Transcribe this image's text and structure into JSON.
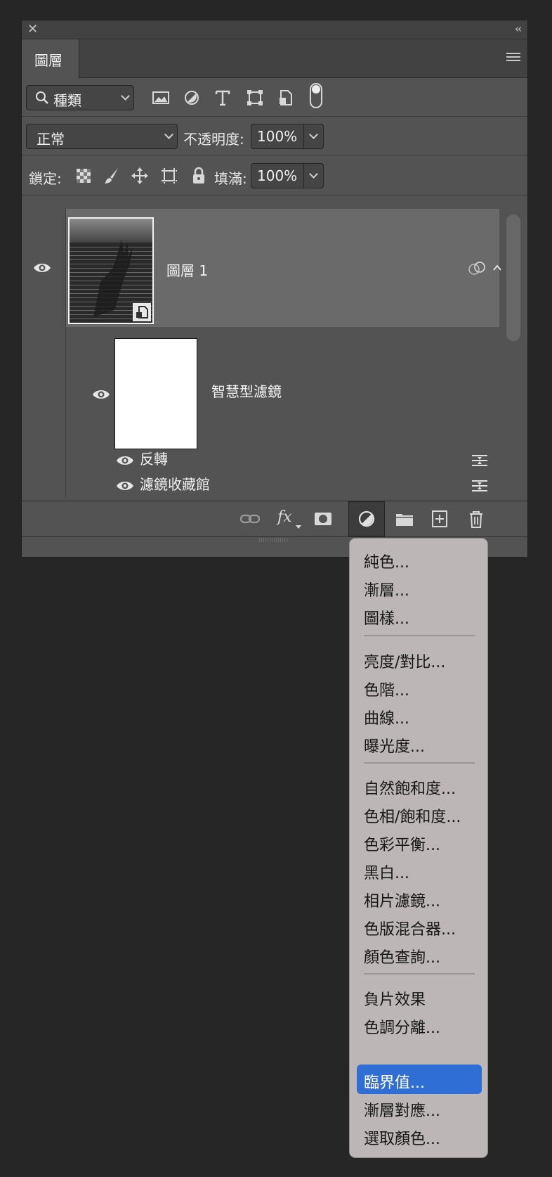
{
  "panel": {
    "tab_label": "圖層",
    "filter": {
      "label": "種類"
    },
    "blend": {
      "mode": "正常",
      "opacity_label": "不透明度:",
      "opacity_value": "100%"
    },
    "lock": {
      "label": "鎖定:",
      "fill_label": "填滿:",
      "fill_value": "100%"
    },
    "layers": [
      {
        "name": "圖層 1"
      }
    ],
    "smart_filters": {
      "label": "智慧型濾鏡",
      "items": [
        {
          "name": "反轉"
        },
        {
          "name": "濾鏡收藏館"
        }
      ]
    },
    "bottom": {
      "fx_label": "fx"
    }
  },
  "dropdown": {
    "items": [
      {
        "label": "純色..."
      },
      {
        "label": "漸層..."
      },
      {
        "label": "圖樣..."
      },
      {
        "label": "亮度/對比..."
      },
      {
        "label": "色階..."
      },
      {
        "label": "曲線..."
      },
      {
        "label": "曝光度..."
      },
      {
        "label": "自然飽和度..."
      },
      {
        "label": "色相/飽和度..."
      },
      {
        "label": "色彩平衡..."
      },
      {
        "label": "黑白..."
      },
      {
        "label": "相片濾鏡..."
      },
      {
        "label": "色版混合器..."
      },
      {
        "label": "顏色查詢..."
      },
      {
        "label": "負片效果"
      },
      {
        "label": "色調分離..."
      },
      {
        "label": "臨界值..."
      },
      {
        "label": "漸層對應..."
      },
      {
        "label": "選取顏色..."
      }
    ],
    "highlighted": "臨界值...",
    "highlight_color": "#2f6fd5"
  }
}
